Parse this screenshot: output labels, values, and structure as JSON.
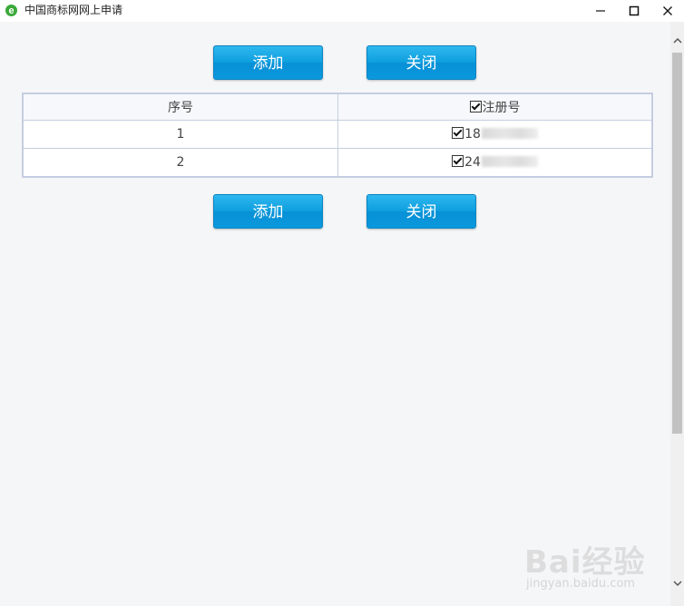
{
  "window": {
    "title": "中国商标网网上申请",
    "app_icon": "ie-icon",
    "controls": [
      "minimize-icon",
      "maximize-icon",
      "close-icon"
    ]
  },
  "toolbar_top": {
    "add_label": "添加",
    "close_label": "关闭"
  },
  "toolbar_bottom": {
    "add_label": "添加",
    "close_label": "关闭"
  },
  "table": {
    "headers": {
      "index": "序号",
      "reg_no": "注册号"
    },
    "header_checkbox_checked": true,
    "rows": [
      {
        "index": "1",
        "reg_no_visible": "18",
        "checked": true
      },
      {
        "index": "2",
        "reg_no_visible": "24",
        "checked": true
      }
    ]
  },
  "watermark": {
    "text": "Bai经验",
    "sub": "jingyan.baidu.com"
  },
  "colors": {
    "button": "#0d9ede",
    "table_border": "#c5cde0",
    "background": "#f5f6f8"
  }
}
